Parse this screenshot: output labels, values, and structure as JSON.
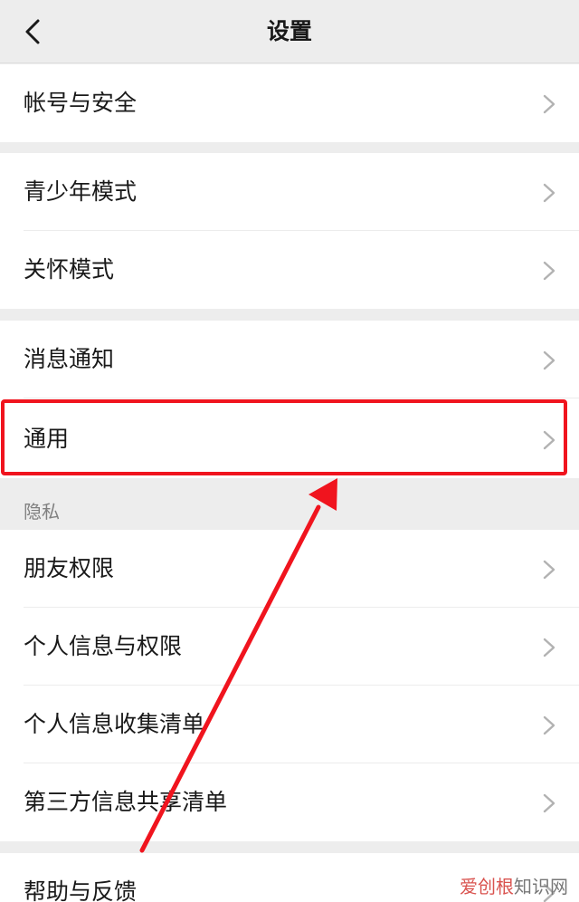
{
  "header": {
    "title": "设置",
    "back_icon": "chevron-left-icon"
  },
  "groups": [
    {
      "items": [
        {
          "label": "帐号与安全"
        }
      ]
    },
    {
      "items": [
        {
          "label": "青少年模式"
        },
        {
          "label": "关怀模式"
        }
      ]
    },
    {
      "items": [
        {
          "label": "消息通知"
        },
        {
          "label": "通用"
        }
      ]
    },
    {
      "header": "隐私",
      "items": [
        {
          "label": "朋友权限"
        },
        {
          "label": "个人信息与权限"
        },
        {
          "label": "个人信息收集清单"
        },
        {
          "label": "第三方信息共享清单"
        }
      ]
    },
    {
      "items": [
        {
          "label": "帮助与反馈"
        }
      ]
    }
  ],
  "annotation": {
    "highlighted_item": "通用",
    "color": "#f0141e"
  },
  "watermark": {
    "brand": "爱创根",
    "suffix": "知识网"
  },
  "colors": {
    "background": "#ededed",
    "row": "#ffffff",
    "text": "#191919",
    "chevron": "#b2b2b2"
  }
}
